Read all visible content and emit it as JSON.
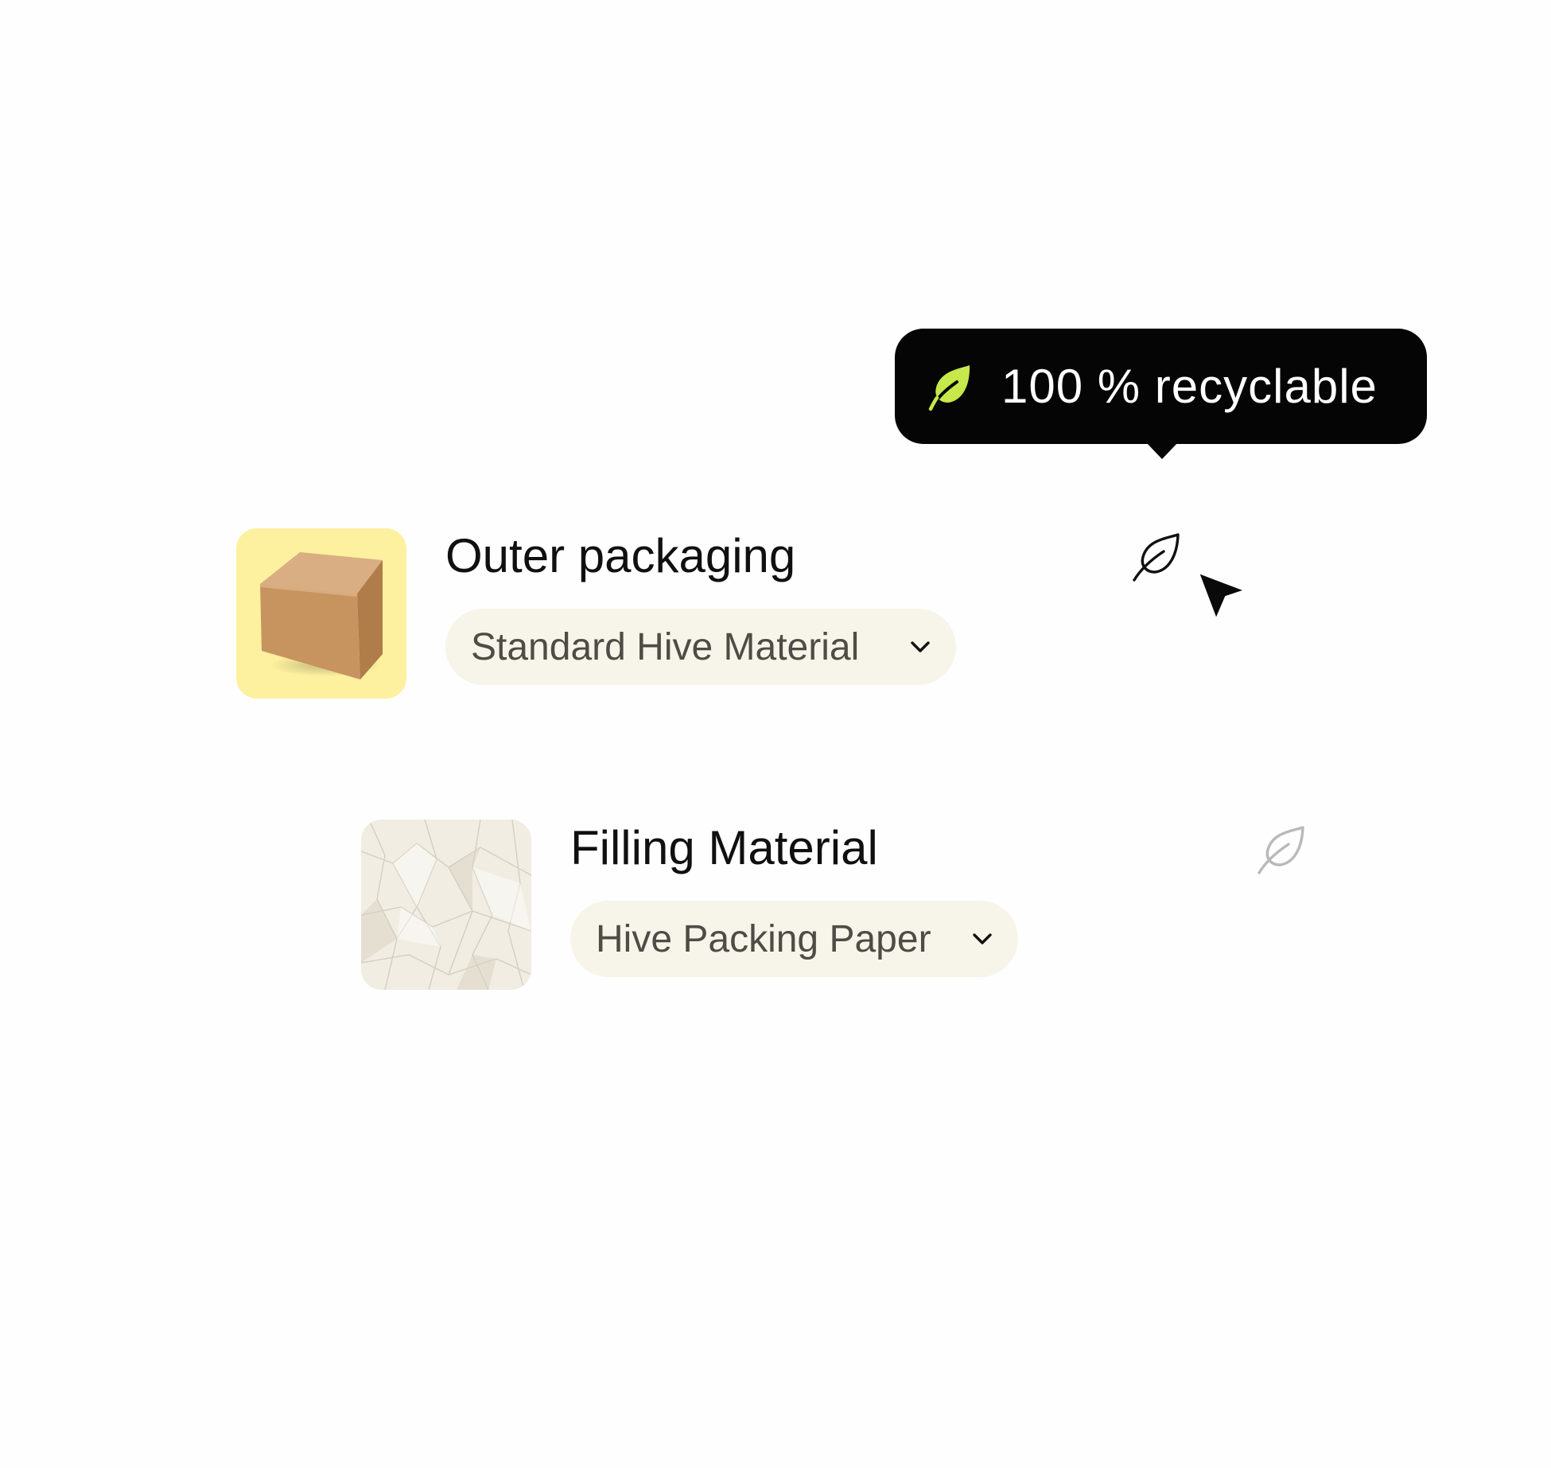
{
  "tooltip": {
    "icon": "leaf-filled-icon",
    "text": "100 % recyclable",
    "icon_color": "#c6e84a"
  },
  "packaging_rows": [
    {
      "title": "Outer packaging",
      "image": "cardboard-box",
      "thumb_color": "#fdf09f",
      "selected_material": "Standard Hive Material",
      "recyclable_icon": "leaf-outline-icon",
      "icon_state": "active"
    },
    {
      "title": "Filling Material",
      "image": "crumpled-paper",
      "thumb_color": "#f0ece1",
      "selected_material": "Hive Packing Paper",
      "recyclable_icon": "leaf-outline-icon",
      "icon_state": "inactive"
    }
  ],
  "colors": {
    "tooltip_bg": "#050505",
    "select_bg": "#f7f4e9",
    "active_icon": "#111111",
    "inactive_icon": "#b9b9b9"
  }
}
